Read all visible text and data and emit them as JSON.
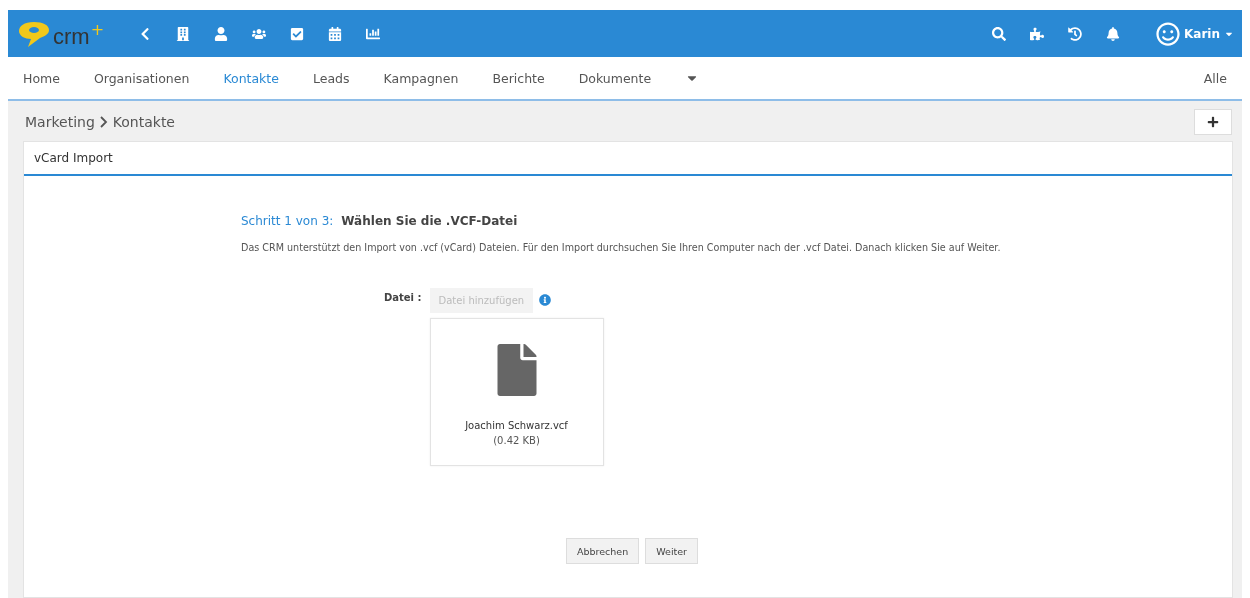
{
  "logo": {
    "text": "crm",
    "mark": "+"
  },
  "user": {
    "name": "Karin"
  },
  "nav": [
    {
      "label": "Home",
      "selected": false
    },
    {
      "label": "Organisationen",
      "selected": false
    },
    {
      "label": "Kontakte",
      "selected": true
    },
    {
      "label": "Leads",
      "selected": false
    },
    {
      "label": "Kampagnen",
      "selected": false
    },
    {
      "label": "Berichte",
      "selected": false
    },
    {
      "label": "Dokumente",
      "selected": false
    }
  ],
  "nav_right": "Alle",
  "breadcrumb": [
    "Marketing",
    "Kontakte"
  ],
  "panel": {
    "title": "vCard Import",
    "step": "Schritt 1 von 3:",
    "step_title": "Wählen Sie die .VCF-Datei",
    "description": "Das CRM unterstützt den Import von .vcf (vCard) Dateien. Für den Import durchsuchen Sie Ihren Computer nach der .vcf Datei. Danach klicken Sie auf Weiter.",
    "file_label": "Datei :",
    "add_button": {
      "label": "Datei hinzufügen",
      "disabled": true
    },
    "file": {
      "name": "Joachim Schwarz.vcf",
      "size": "(0.42 KB)"
    },
    "buttons": [
      "Abbrechen",
      "Weiter"
    ]
  }
}
